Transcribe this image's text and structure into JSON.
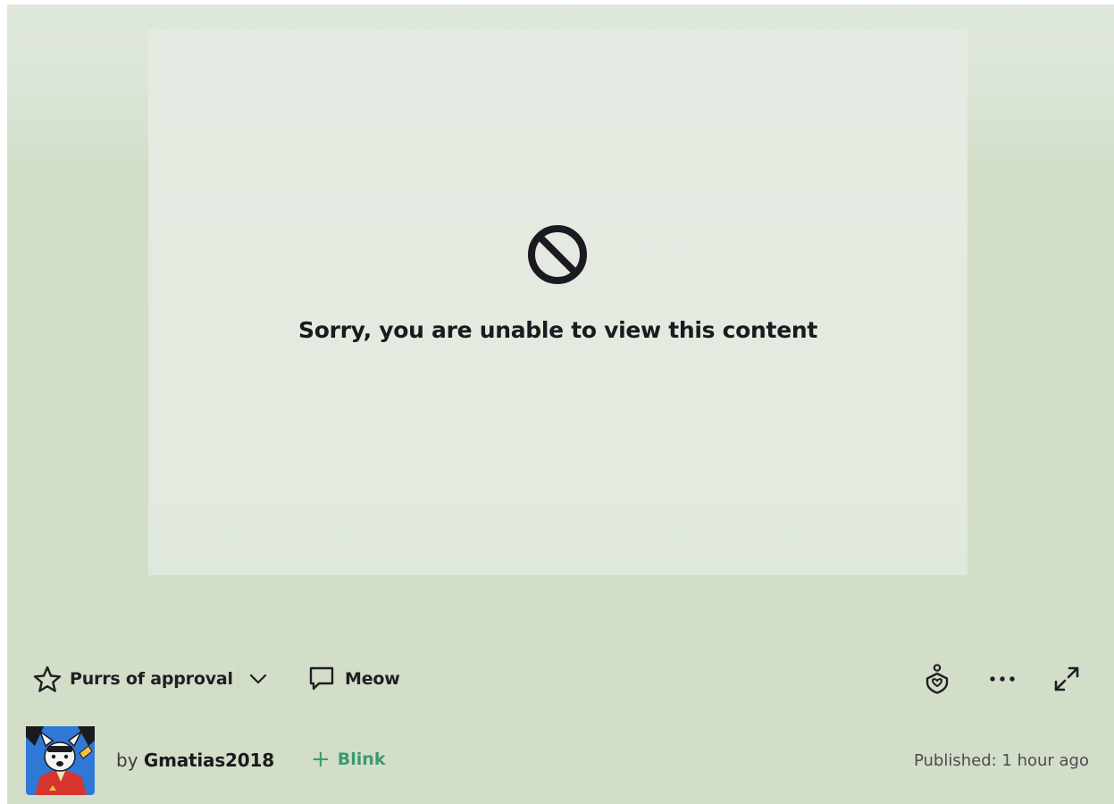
{
  "blocked": {
    "message": "Sorry, you are unable to view this content",
    "icon": "blocked-icon"
  },
  "actions": {
    "fave_label": "Purrs of approval",
    "fave_icon": "star-outline-icon",
    "dropdown_icon": "chevron-down-icon",
    "comment_label": "Meow",
    "comment_icon": "speech-bubble-icon",
    "gift_icon": "gift-icon",
    "more_icon": "more-dots-icon",
    "expand_icon": "expand-arrows-icon"
  },
  "author": {
    "by_prefix": "by",
    "username": "Gmatias2018",
    "watch_label": "Blink",
    "published": "Published: 1 hour ago",
    "avatar_icon": "avatar-image"
  },
  "colors": {
    "background": "#d3dec9",
    "panel": "#e4ebe2",
    "text": "#1a1a1f",
    "accent_green": "#3c9a6c",
    "avatar_blue": "#2f78d6"
  }
}
